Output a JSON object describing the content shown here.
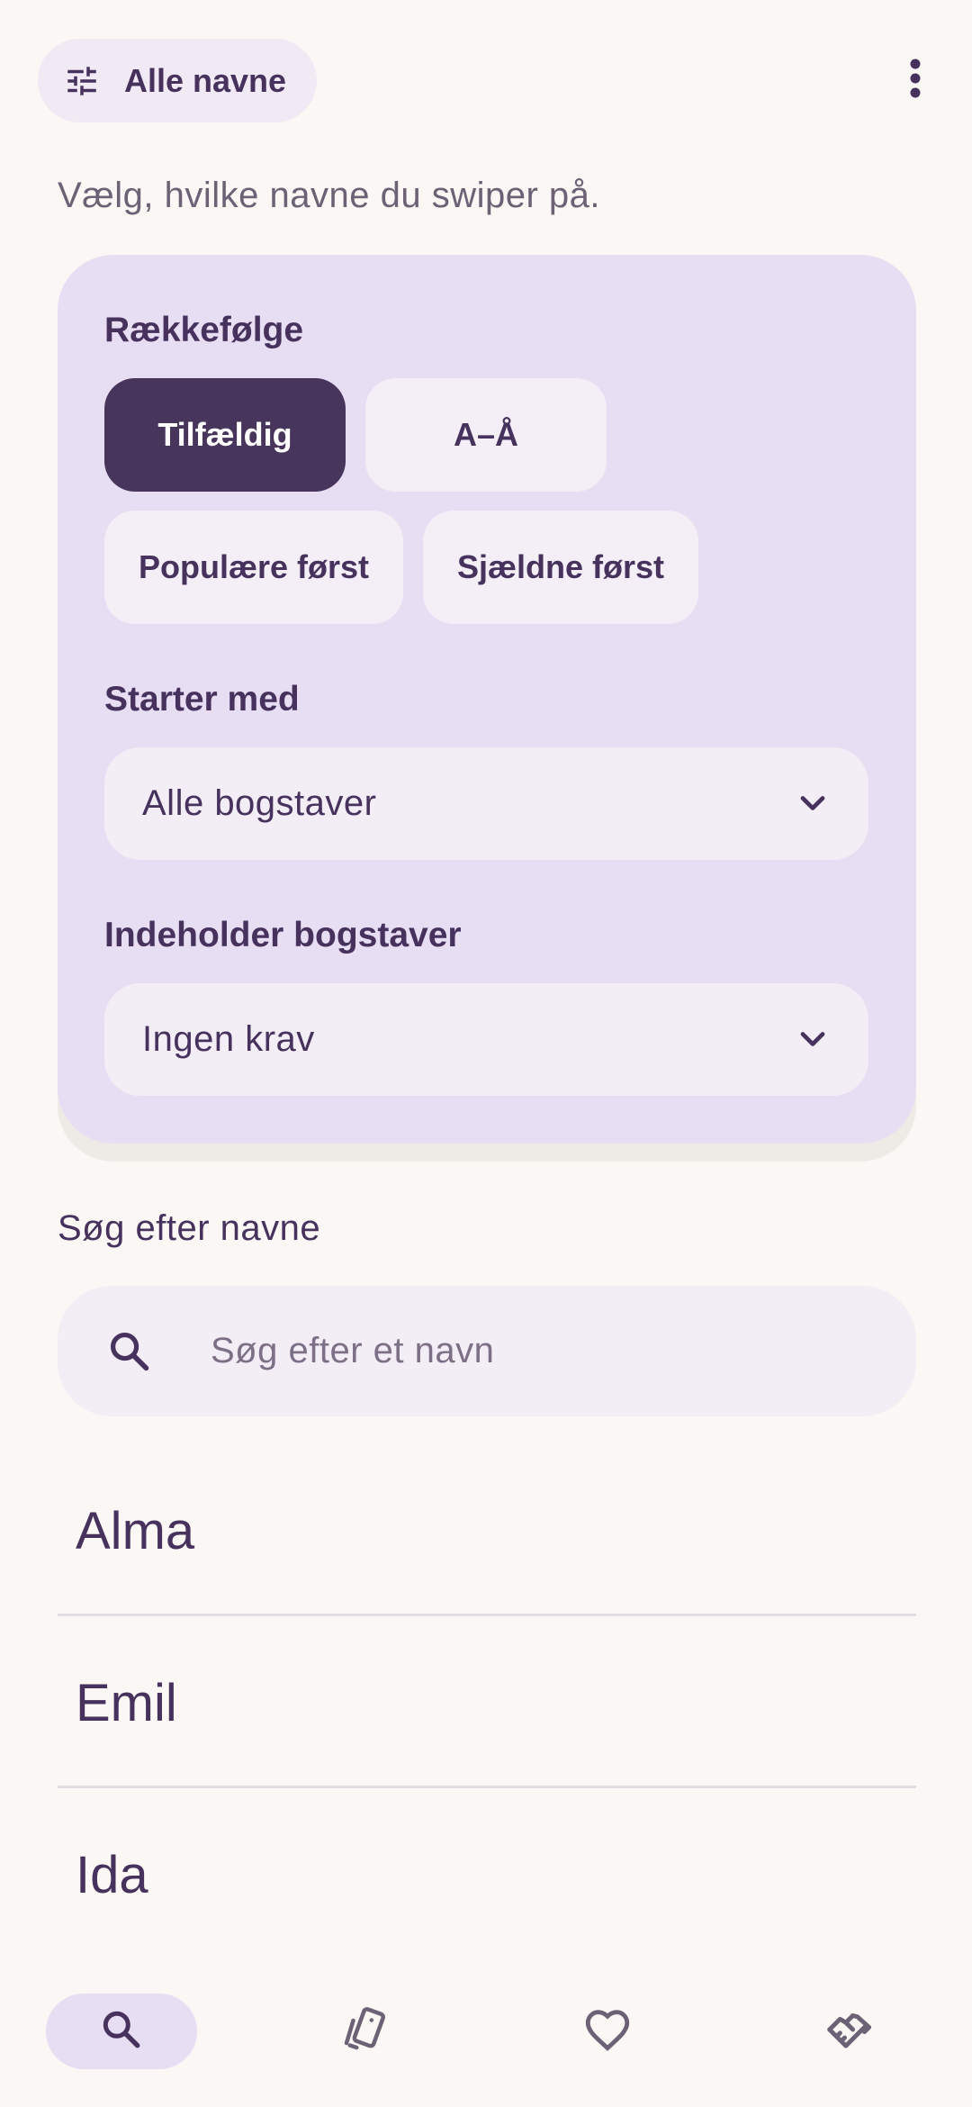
{
  "top_bar": {
    "filter_chip_label": "Alle navne",
    "filter_icon": "tune-icon",
    "more_icon": "more-vert-icon"
  },
  "subtitle": "Vælg, hvilke navne du swiper på.",
  "filters": {
    "order_label": "Rækkefølge",
    "order_options": [
      {
        "label": "Tilfældig",
        "selected": true
      },
      {
        "label": "A–Å",
        "selected": false
      },
      {
        "label": "Populære først",
        "selected": false
      },
      {
        "label": "Sjældne først",
        "selected": false
      }
    ],
    "starts_with_label": "Starter med",
    "starts_with_value": "Alle bogstaver",
    "contains_label": "Indeholder bogstaver",
    "contains_value": "Ingen krav"
  },
  "search": {
    "title": "Søg efter navne",
    "placeholder": "Søg efter et navn",
    "value": ""
  },
  "names": [
    "Alma",
    "Emil",
    "Ida"
  ],
  "bottom_nav": {
    "items": [
      {
        "icon": "search-icon",
        "active": true
      },
      {
        "icon": "swipe-cards-icon",
        "active": false
      },
      {
        "icon": "heart-icon",
        "active": false
      },
      {
        "icon": "handshake-icon",
        "active": false
      }
    ]
  },
  "colors": {
    "background": "#FAF7F4",
    "card": "#E8DEF4",
    "primary": "#48355C",
    "surface": "#F3EDF6"
  }
}
